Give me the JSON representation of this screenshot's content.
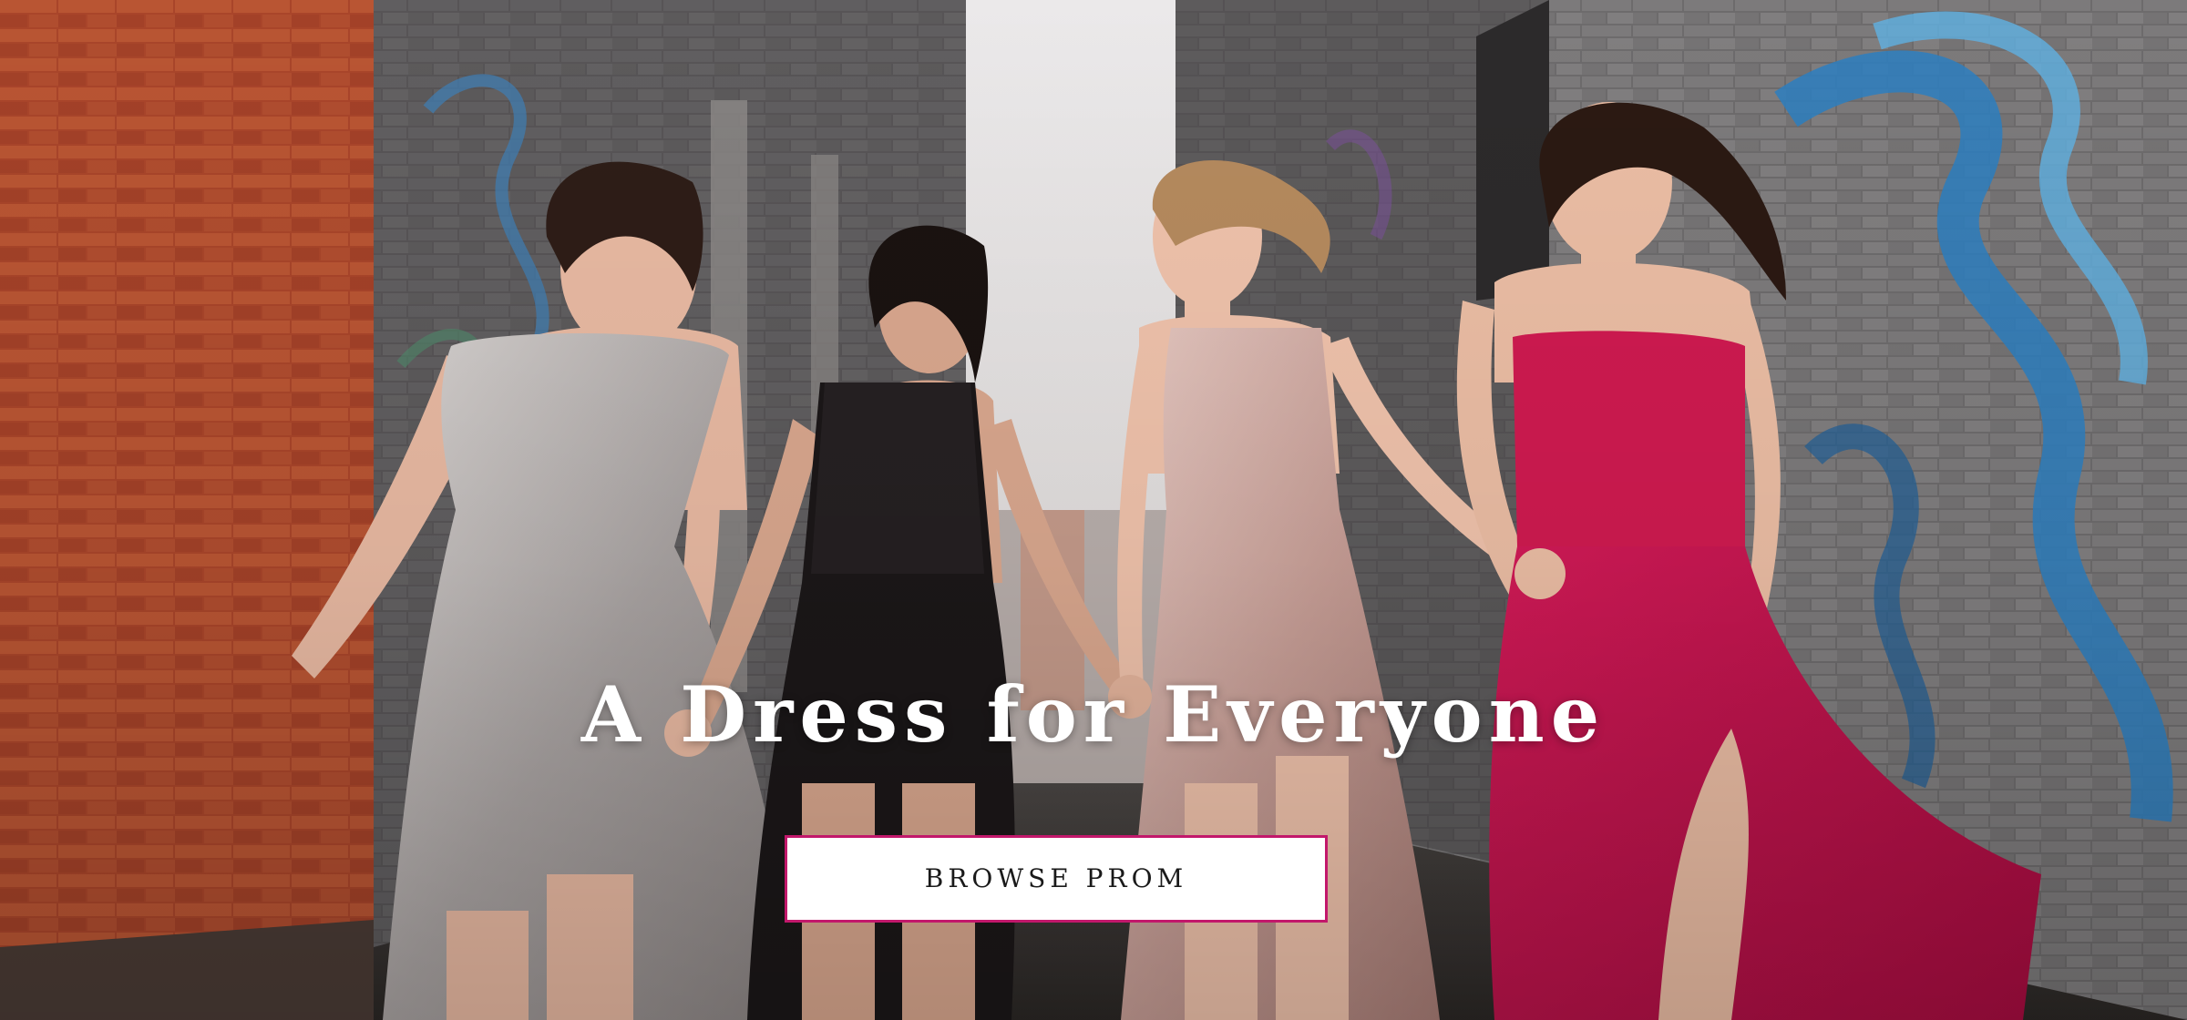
{
  "hero": {
    "title": "A Dress for Everyone",
    "cta_label": "BROWSE PROM"
  },
  "colors": {
    "cta_border": "#c2186b",
    "cta_background": "#ffffff",
    "title_text": "#ffffff"
  }
}
